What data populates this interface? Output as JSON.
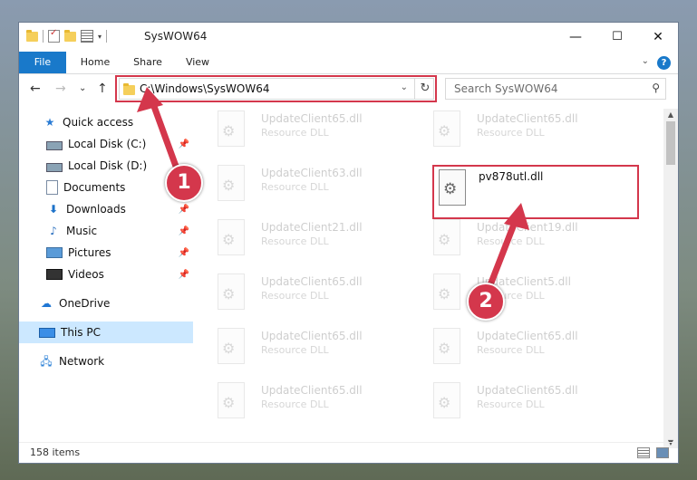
{
  "window": {
    "title": "SysWOW64",
    "minimize": "—",
    "maximize": "☐",
    "close": "✕"
  },
  "ribbon": {
    "tabs": [
      "File",
      "Home",
      "Share",
      "View"
    ],
    "help": "?"
  },
  "nav": {
    "back": "←",
    "forward": "→",
    "recent": "⌄",
    "up": "↑",
    "address": "C:\\Windows\\SysWOW64",
    "refresh": "↻",
    "search_placeholder": "Search SysWOW64"
  },
  "sidebar": {
    "items": [
      {
        "label": "Quick access",
        "icon": "star-icon"
      },
      {
        "label": "Local Disk (C:)",
        "icon": "disk-icon",
        "pinned": true
      },
      {
        "label": "Local Disk (D:)",
        "icon": "disk-icon",
        "pinned": false
      },
      {
        "label": "Documents",
        "icon": "document-icon",
        "pinned": true
      },
      {
        "label": "Downloads",
        "icon": "download-icon",
        "pinned": true
      },
      {
        "label": "Music",
        "icon": "music-icon",
        "pinned": true
      },
      {
        "label": "Pictures",
        "icon": "pictures-icon",
        "pinned": true
      },
      {
        "label": "Videos",
        "icon": "videos-icon",
        "pinned": true
      },
      {
        "label": "OneDrive",
        "icon": "cloud-icon"
      },
      {
        "label": "This PC",
        "icon": "computer-icon",
        "selected": true
      },
      {
        "label": "Network",
        "icon": "network-icon"
      }
    ]
  },
  "files": {
    "background": [
      {
        "name": "UpdateClient65.dll",
        "type": "Resource DLL"
      },
      {
        "name": "UpdateClient65.dll",
        "type": "Resource DLL"
      },
      {
        "name": "UpdateClient63.dll",
        "type": "Resource DLL"
      },
      {
        "name": "UpdateClient21.dll",
        "type": "Resource DLL"
      },
      {
        "name": "UpdateClient19.dll",
        "type": "Resource DLL"
      },
      {
        "name": "UpdateClient65.dll",
        "type": "Resource DLL"
      },
      {
        "name": "UpdateClient5.dll",
        "type": "Resource DLL"
      },
      {
        "name": "UpdateClient65.dll",
        "type": "Resource DLL"
      },
      {
        "name": "UpdateClient65.dll",
        "type": "Resource DLL"
      },
      {
        "name": "UpdateClient65.dll",
        "type": "Resource DLL"
      },
      {
        "name": "UpdateClient65.dll",
        "type": "Resource DLL"
      }
    ],
    "target": {
      "name": "pv878utl.dll"
    }
  },
  "annotations": {
    "step1": "1",
    "step2": "2",
    "color": "#d4374c"
  },
  "status": {
    "count": "158 items"
  }
}
